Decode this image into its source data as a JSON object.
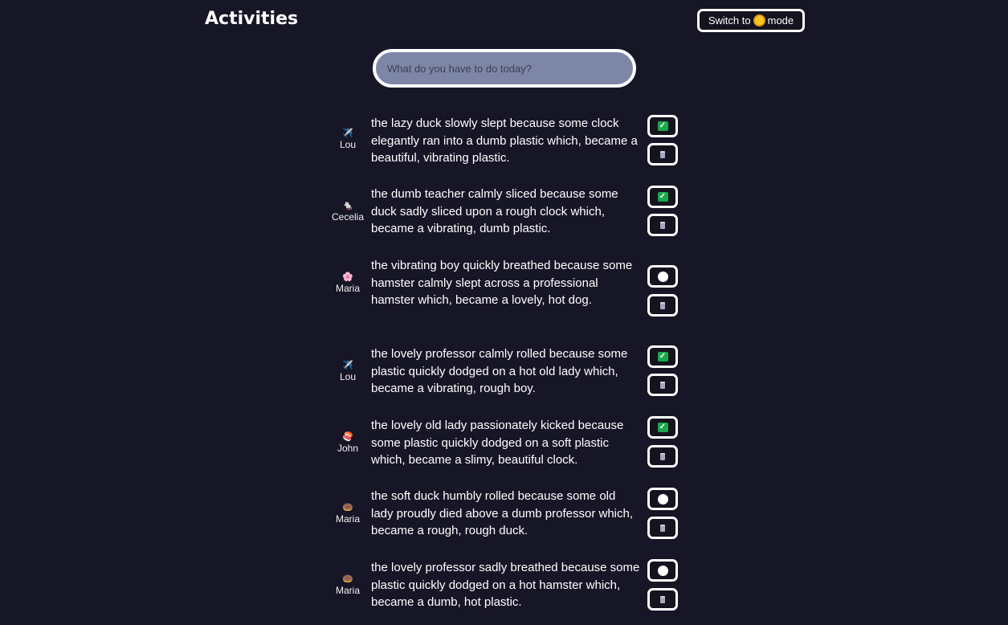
{
  "header": {
    "title": "Activities",
    "mode_button": {
      "prefix": "Switch to",
      "icon": "sun-icon",
      "suffix": "mode"
    }
  },
  "search": {
    "placeholder": "What do you have to do today?",
    "value": ""
  },
  "activities": [
    {
      "user": "Lou",
      "emoji": "✈️",
      "text": "the lazy duck slowly slept because some clock elegantly ran into a dumb plastic which, became a beautiful, vibrating plastic.",
      "done": true
    },
    {
      "user": "Cecelia",
      "emoji": "🐁",
      "text": "the dumb teacher calmly sliced because some duck sadly sliced upon a rough clock which, became a vibrating, dumb plastic.",
      "done": true
    },
    {
      "user": "Maria",
      "emoji": "🌸",
      "text": "the vibrating boy quickly breathed because some hamster calmly slept across a professional hamster which, became a lovely, hot dog.",
      "done": false
    },
    {
      "user": "Lou",
      "emoji": "✈️",
      "text": "the lovely professor calmly rolled because some plastic quickly dodged on a hot old lady which, became a vibrating, rough boy.",
      "done": true
    },
    {
      "user": "John",
      "emoji": "🍣",
      "text": "the lovely old lady passionately kicked because some plastic quickly dodged on a soft plastic which, became a slimy, beautiful clock.",
      "done": true
    },
    {
      "user": "Maria",
      "emoji": "🍩",
      "text": "the soft duck humbly rolled because some old lady proudly died above a dumb professor which, became a rough, rough duck.",
      "done": false
    },
    {
      "user": "Maria",
      "emoji": "🍩",
      "text": "the lovely professor sadly breathed because some plastic quickly dodged on a hot hamster which, became a dumb, hot plastic.",
      "done": false
    }
  ],
  "colors": {
    "background": "#171627",
    "search_fill": "#7d86a7",
    "check_green": "#19a84a",
    "sun": "#f7c625"
  }
}
